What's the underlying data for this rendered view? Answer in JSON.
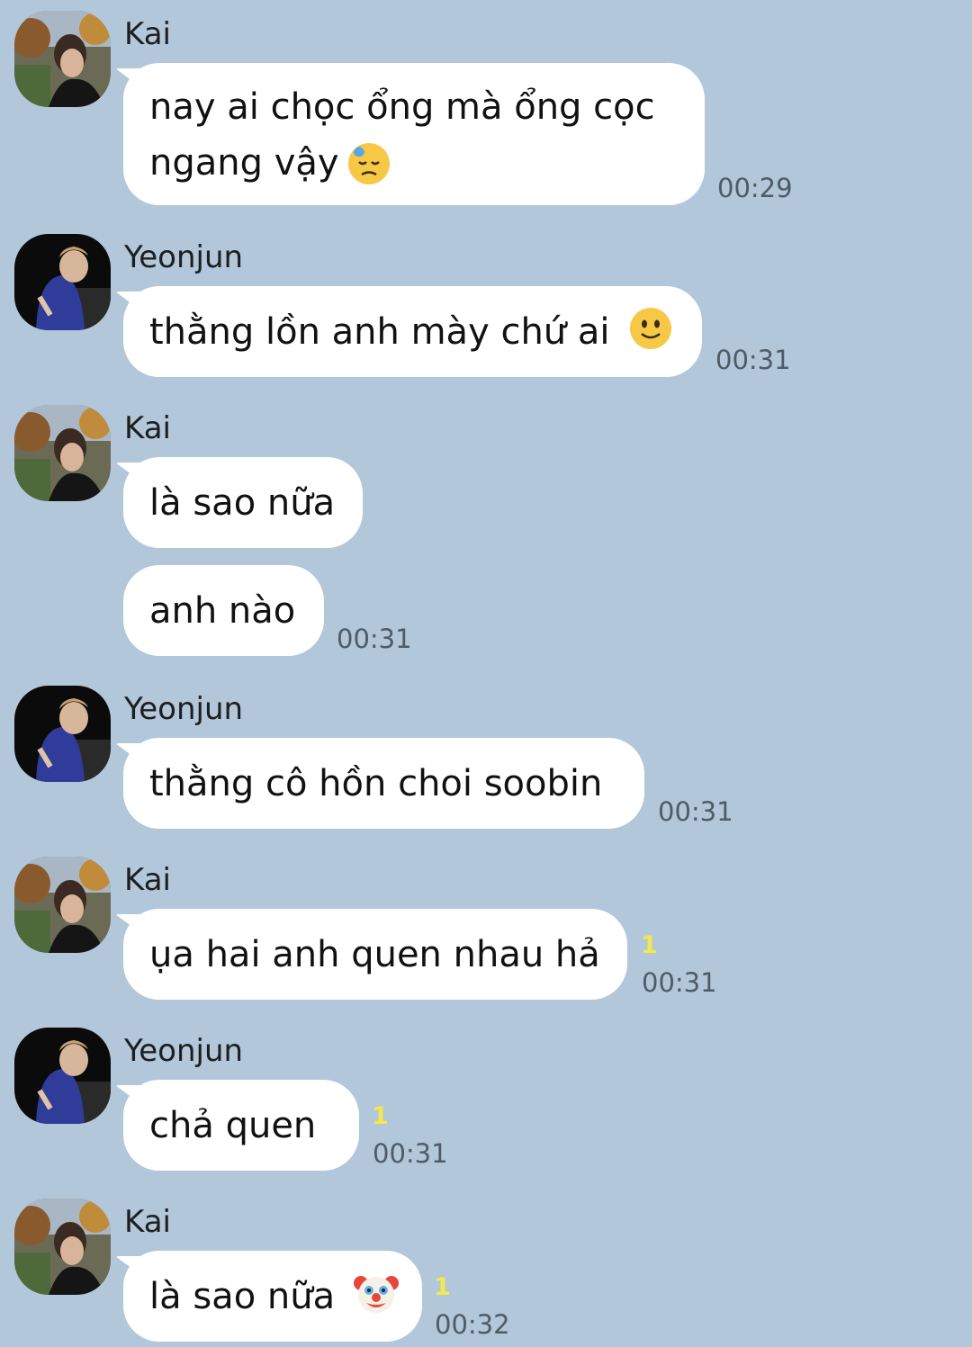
{
  "messages": [
    {
      "sender": "Kai",
      "text": "nay ai chọc ổng mà ổng cọc",
      "text2": "ngang vậy",
      "emoji": "downcast-sweat-face-emoji",
      "time": "00:29"
    },
    {
      "sender": "Yeonjun",
      "text": "thằng lồn anh mày chứ ai",
      "emoji": "slightly-smiling-face-emoji",
      "time": "00:31"
    },
    {
      "sender": "Kai",
      "text": "là sao nữa"
    },
    {
      "text": "anh nào",
      "time": "00:31"
    },
    {
      "sender": "Yeonjun",
      "text": "thằng cô hồn choi soobin",
      "time": "00:31"
    },
    {
      "sender": "Kai",
      "text": "ụa hai anh quen nhau hả",
      "unread": "1",
      "time": "00:31"
    },
    {
      "sender": "Yeonjun",
      "text": "chả quen",
      "unread": "1",
      "time": "00:31"
    },
    {
      "sender": "Kai",
      "text": "là sao nữa",
      "emoji": "clown-face-emoji",
      "unread": "1",
      "time": "00:32"
    }
  ],
  "colors": {
    "background": "#b2c7da",
    "bubble": "#ffffff",
    "unread": "#f5e84a",
    "time": "#4f5b66"
  }
}
